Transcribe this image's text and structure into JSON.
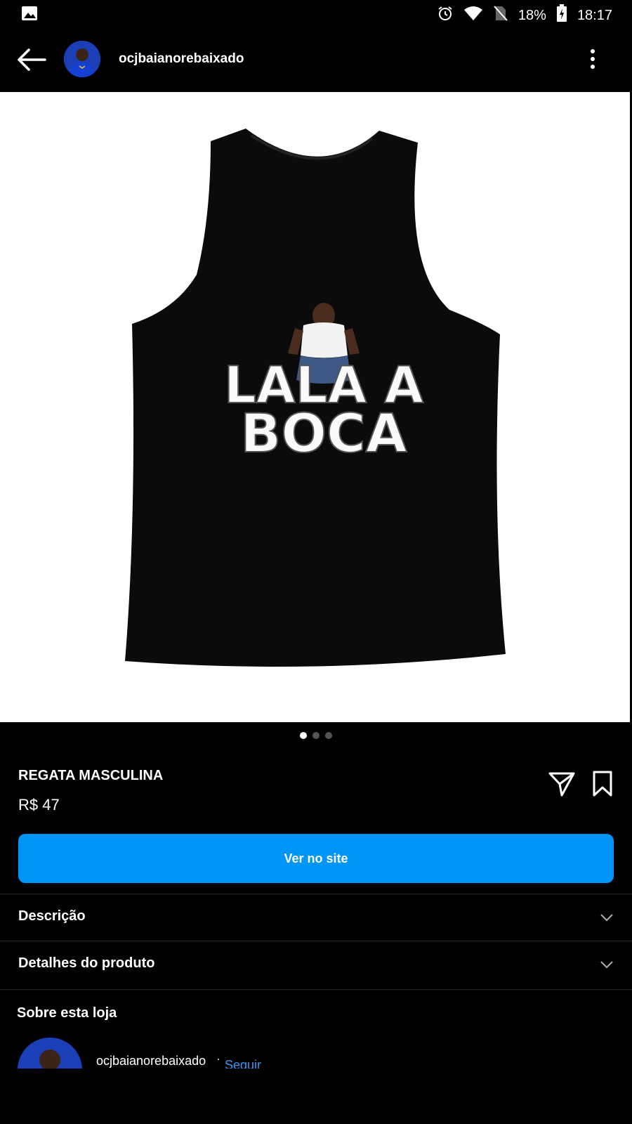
{
  "status_bar": {
    "battery": "18%",
    "time": "18:17",
    "icons": [
      "image-icon",
      "alarm-icon",
      "wifi-icon",
      "no-sim-icon",
      "battery-charging-icon"
    ]
  },
  "header": {
    "username": "ocjbaianorebaixado",
    "icons": [
      "back-arrow-icon",
      "more-vertical-icon"
    ]
  },
  "product_image": {
    "text_lines": [
      "LALA A",
      "BOCA"
    ]
  },
  "carousel": {
    "total": 3,
    "active": 1
  },
  "product": {
    "name": "REGATA MASCULINA",
    "price": "R$ 47",
    "cta_label": "Ver no site",
    "icons": [
      "send-icon",
      "bookmark-icon"
    ]
  },
  "sections": {
    "description_label": "Descrição",
    "details_label": "Detalhes do produto"
  },
  "store": {
    "title": "Sobre esta loja",
    "name": "ocjbaianorebaixado",
    "separator": "·",
    "follow_label": "Seguir"
  },
  "colors": {
    "background": "#000000",
    "accent": "#0095f6",
    "link": "#3897f0"
  }
}
